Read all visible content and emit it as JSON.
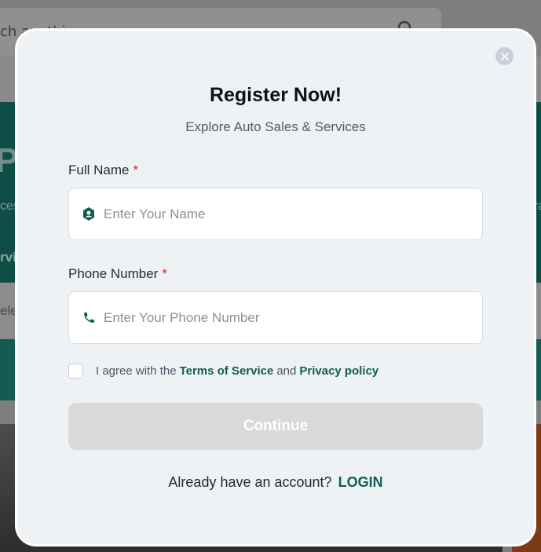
{
  "background": {
    "search_text": "ch anything",
    "teal_big": "Pa",
    "teal_line_left": "ces",
    "teal_line_right": "ra",
    "teal_bold": "rvic",
    "gray_text": "ele"
  },
  "modal": {
    "title": "Register Now!",
    "subtitle": "Explore Auto Sales & Services",
    "full_name": {
      "label": "Full Name",
      "required_mark": "*",
      "placeholder": "Enter Your Name",
      "value": ""
    },
    "phone": {
      "label": "Phone Number",
      "required_mark": "*",
      "placeholder": "Enter Your Phone Number",
      "value": ""
    },
    "agreement": {
      "prefix": "I agree with the",
      "terms_link": "Terms of Service",
      "and": "and",
      "privacy_link": "Privacy policy",
      "checked": false
    },
    "continue_label": "Continue",
    "login_prompt": "Already have an account?",
    "login_link": "LOGIN"
  },
  "icons": [
    "close-icon",
    "user-icon",
    "phone-icon",
    "search-icon"
  ],
  "colors": {
    "accent": "#0f5e55",
    "required": "#e02424",
    "disabled_button": "#d9d9d9",
    "modal_bg": "#eff2f5"
  }
}
